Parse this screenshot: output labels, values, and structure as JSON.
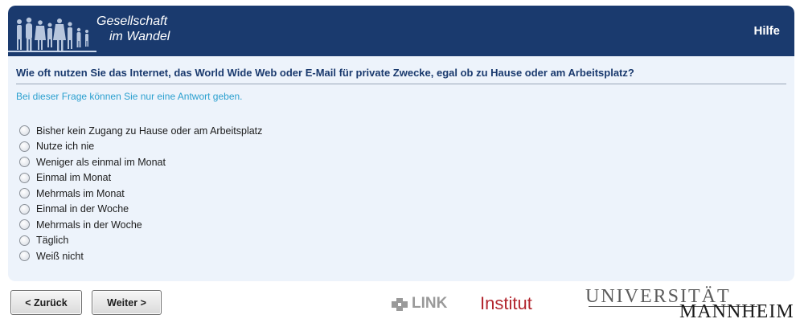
{
  "header": {
    "logo_line1": "Gesellschaft",
    "logo_line2": "im Wandel",
    "help_label": "Hilfe"
  },
  "question": {
    "text": "Wie oft nutzen Sie das Internet, das World Wide Web oder E-Mail für private Zwecke, egal ob zu Hause oder am Arbeitsplatz?",
    "instruction": "Bei dieser Frage können Sie nur eine Antwort geben."
  },
  "options": [
    "Bisher kein Zugang zu Hause oder am Arbeitsplatz",
    "Nutze ich nie",
    "Weniger als einmal im Monat",
    "Einmal im Monat",
    "Mehrmals im Monat",
    "Einmal in der Woche",
    "Mehrmals in der Woche",
    "Täglich",
    "Weiß nicht"
  ],
  "navigation": {
    "back_label": "< Zurück",
    "next_label": "Weiter >"
  },
  "footer": {
    "link_word": "LINK",
    "link_institut": "Institut",
    "uni_top": "UNIVERSITÄT",
    "uni_bottom": "MANNHEIM"
  },
  "colors": {
    "header_bg": "#1a3a6e",
    "panel_bg": "#edf3fb",
    "question_text": "#1a3a6e",
    "instruction_text": "#2ba0cf",
    "link_red": "#b2262e"
  }
}
